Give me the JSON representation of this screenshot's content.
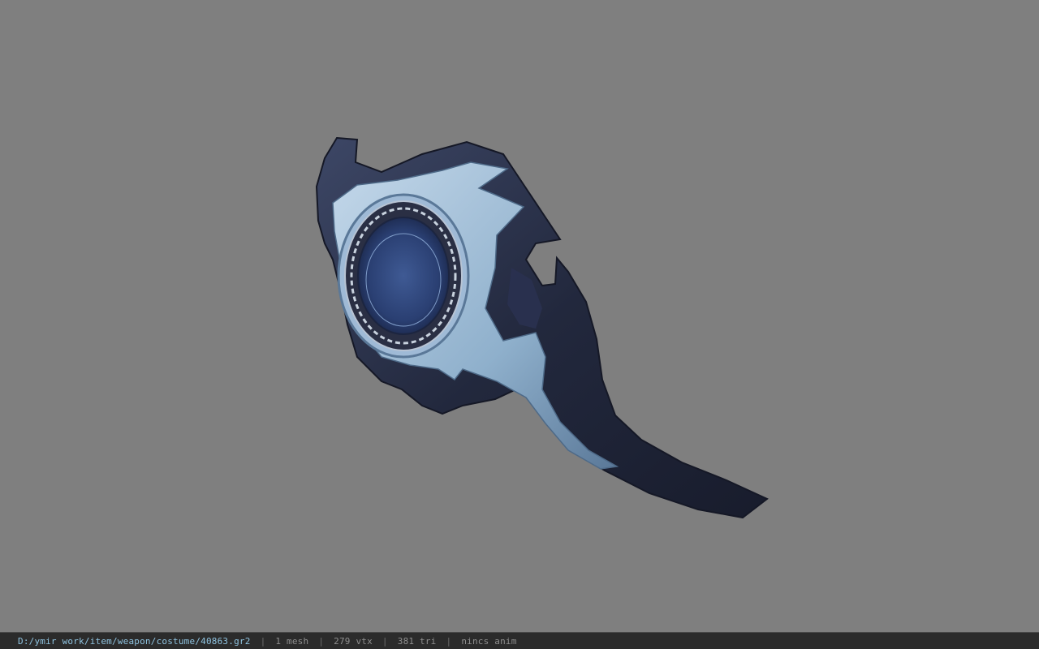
{
  "viewer": {
    "background_color": "#7f7f7f",
    "model_icon": "weapon-model-icon"
  },
  "statusbar": {
    "file_path": "D:/ymir work/item/weapon/costume/40863.gr2",
    "separator": "|",
    "mesh_count": "1 mesh",
    "vertex_count": "279 vtx",
    "triangle_count": "381 tri",
    "anim_status": "nincs anim",
    "path_color": "#8fc3e0",
    "text_color": "#8f8f8f"
  }
}
